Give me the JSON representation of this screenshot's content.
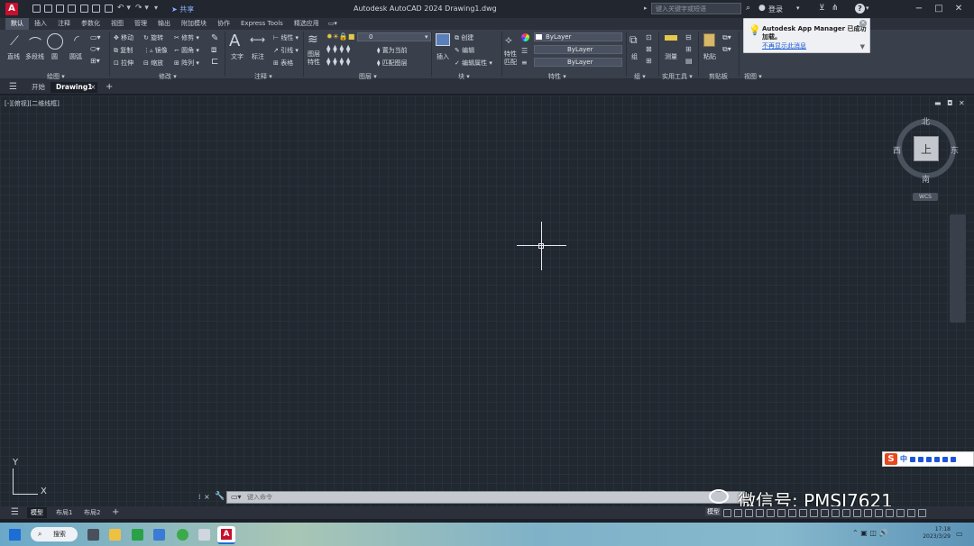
{
  "titlebar": {
    "logo": "A",
    "share": "共享",
    "title": "Autodesk AutoCAD 2024    Drawing1.dwg",
    "search_placeholder": "键入关键字或短语",
    "login": "登录",
    "help": "?"
  },
  "ribbon_tabs": [
    "默认",
    "插入",
    "注释",
    "参数化",
    "视图",
    "管理",
    "输出",
    "附加模块",
    "协作",
    "Express Tools",
    "精选应用"
  ],
  "ribbon": {
    "draw": {
      "label": "绘图 ▾",
      "line": "直线",
      "polyline": "多段线",
      "circle": "圆",
      "arc": "圆弧"
    },
    "modify": {
      "label": "修改 ▾",
      "move": "移动",
      "rotate": "旋转",
      "trim": "修剪",
      "copy": "复制",
      "mirror": "镜像",
      "fillet": "圆角",
      "stretch": "拉伸",
      "scale": "缩放",
      "array": "阵列"
    },
    "annotation": {
      "label": "注释 ▾",
      "text": "文字",
      "dimension": "标注",
      "linear": "线性",
      "leader": "引线",
      "table": "表格"
    },
    "layers": {
      "label": "图层 ▾",
      "properties": "图层特性",
      "layer_value": "0",
      "make_current": "置为当前",
      "match_layer": "匹配图层"
    },
    "block": {
      "label": "块 ▾",
      "insert": "插入",
      "create": "创建",
      "edit": "编辑",
      "edit_attr": "编辑属性"
    },
    "properties": {
      "label": "特性 ▾",
      "match": "特性匹配",
      "color": "ByLayer",
      "linetype": "ByLayer",
      "lineweight": "ByLayer"
    },
    "groups": {
      "label": "组 ▾",
      "group": "组"
    },
    "utilities": {
      "label": "实用工具 ▾",
      "measure": "测量"
    },
    "clipboard": {
      "label": "剪贴板",
      "paste": "粘贴"
    },
    "view": {
      "label": "视图 ▾"
    }
  },
  "notification": {
    "title": "Autodesk App Manager 已成功",
    "title2": "加载。",
    "link": "不再显示此消息"
  },
  "doc_tabs": {
    "start": "开始",
    "active": "Drawing1",
    "close": "×",
    "add": "+"
  },
  "canvas": {
    "view_label": "[-][俯视][二维线框]",
    "viewcube": {
      "top": "上",
      "north": "北",
      "south": "南",
      "east": "东",
      "west": "西",
      "wcs": "WCS"
    },
    "ucs": {
      "x": "X",
      "y": "Y"
    }
  },
  "command_line": {
    "placeholder": "键入命令",
    "close": "×"
  },
  "layout_tabs": {
    "model": "模型",
    "layout1": "布局1",
    "layout2": "布局2",
    "add": "+"
  },
  "status": {
    "model": "模型"
  },
  "ime": {
    "logo": "S",
    "lang": "中"
  },
  "watermark": "微信号: PMSJ7621",
  "taskbar": {
    "search": "搜索",
    "time": "17:18",
    "date": "2023/3/29"
  }
}
